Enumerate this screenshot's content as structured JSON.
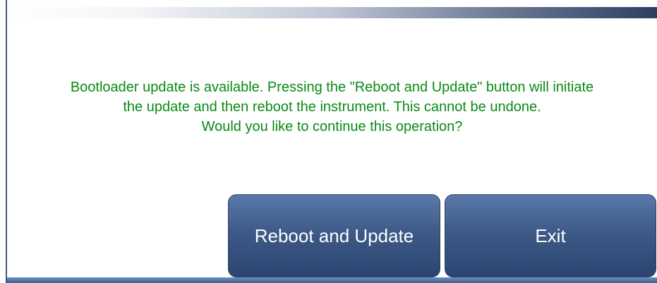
{
  "dialog": {
    "message_lines": [
      "Bootloader update is available. Pressing the \"Reboot and Update\" button will initiate",
      "the update and then reboot the instrument. This cannot be undone.",
      "Would you like to continue this operation?"
    ],
    "message_color": "#0a8a14"
  },
  "buttons": {
    "reboot_label": "Reboot and Update",
    "exit_label": "Exit"
  },
  "colors": {
    "button": "#3e5a88",
    "header_gradient_end": "#2f3d62"
  }
}
